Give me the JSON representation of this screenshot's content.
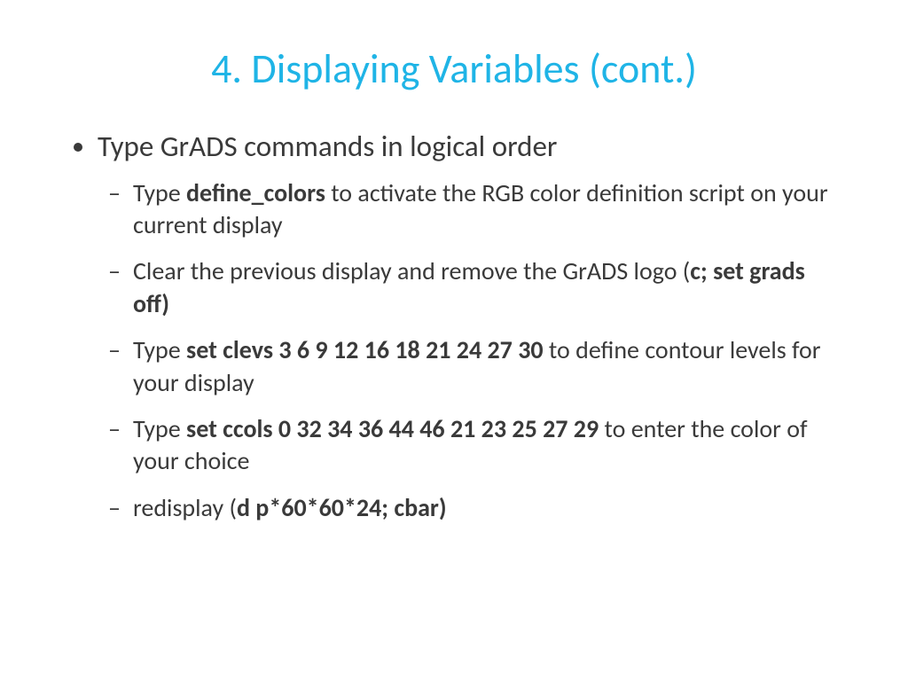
{
  "title": "4. Displaying Variables (cont.)",
  "bullet1": "Type GrADS commands in logical order",
  "sub1_pre": "Type ",
  "sub1_bold": "define_colors",
  "sub1_post": " to activate the RGB color definition script on your current display",
  "sub2_pre": "Clear the previous display and remove the GrADS logo (",
  "sub2_bold": "c; set grads off)",
  "sub3_pre": "Type ",
  "sub3_bold": "set clevs 3 6 9 12 16 18 21 24 27 30",
  "sub3_post": " to define contour levels for your display",
  "sub4_pre": "Type ",
  "sub4_bold": "set ccols 0 32 34 36 44 46 21 23 25 27 29",
  "sub4_post": " to enter the color of your choice",
  "sub5_pre": "redisplay (",
  "sub5_bold": "d p*60*60*24; cbar)"
}
